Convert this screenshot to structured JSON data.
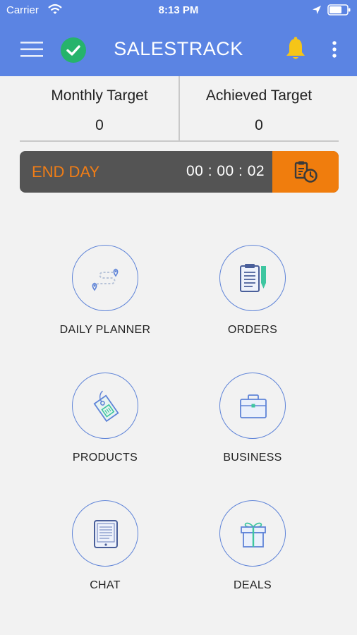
{
  "status_bar": {
    "carrier": "Carrier",
    "time": "8:13 PM"
  },
  "header": {
    "title": "SALESTRACK",
    "background": "#5b84e3",
    "check_color": "#26b36b",
    "bell_color": "#f5c518"
  },
  "targets": {
    "monthly": {
      "label": "Monthly Target",
      "value": "0"
    },
    "achieved": {
      "label": "Achieved Target",
      "value": "0"
    }
  },
  "end_day": {
    "label": "END DAY",
    "timer": "00 : 00 : 02",
    "accent": "#f07d0d"
  },
  "tiles": [
    {
      "label": "DAILY PLANNER",
      "icon": "route-map-icon"
    },
    {
      "label": "ORDERS",
      "icon": "clipboard-icon"
    },
    {
      "label": "PRODUCTS",
      "icon": "price-tag-icon"
    },
    {
      "label": "BUSINESS",
      "icon": "briefcase-icon"
    },
    {
      "label": "CHAT",
      "icon": "chat-tablet-icon"
    },
    {
      "label": "DEALS",
      "icon": "gift-icon"
    }
  ]
}
